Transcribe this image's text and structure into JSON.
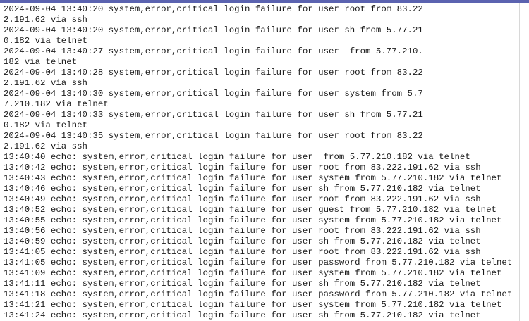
{
  "colors": {
    "top_bar": "#5b63b0",
    "background": "#ffffff",
    "text": "#1a1a1a"
  },
  "log": {
    "lines": [
      "2024-09-04 13:40:20 system,error,critical login failure for user root from 83.22",
      "2.191.62 via ssh",
      "2024-09-04 13:40:20 system,error,critical login failure for user sh from 5.77.21",
      "0.182 via telnet",
      "2024-09-04 13:40:27 system,error,critical login failure for user  from 5.77.210.",
      "182 via telnet",
      "2024-09-04 13:40:28 system,error,critical login failure for user root from 83.22",
      "2.191.62 via ssh",
      "2024-09-04 13:40:30 system,error,critical login failure for user system from 5.7",
      "7.210.182 via telnet",
      "2024-09-04 13:40:33 system,error,critical login failure for user sh from 5.77.21",
      "0.182 via telnet",
      "2024-09-04 13:40:35 system,error,critical login failure for user root from 83.22",
      "2.191.62 via ssh",
      "13:40:40 echo: system,error,critical login failure for user  from 5.77.210.182 via telnet",
      "13:40:42 echo: system,error,critical login failure for user root from 83.222.191.62 via ssh",
      "13:40:43 echo: system,error,critical login failure for user system from 5.77.210.182 via telnet",
      "13:40:46 echo: system,error,critical login failure for user sh from 5.77.210.182 via telnet",
      "13:40:49 echo: system,error,critical login failure for user root from 83.222.191.62 via ssh",
      "13:40:52 echo: system,error,critical login failure for user guest from 5.77.210.182 via telnet",
      "13:40:55 echo: system,error,critical login failure for user system from 5.77.210.182 via telnet",
      "13:40:56 echo: system,error,critical login failure for user root from 83.222.191.62 via ssh",
      "13:40:59 echo: system,error,critical login failure for user sh from 5.77.210.182 via telnet",
      "13:41:05 echo: system,error,critical login failure for user root from 83.222.191.62 via ssh",
      "13:41:05 echo: system,error,critical login failure for user password from 5.77.210.182 via telnet",
      "13:41:09 echo: system,error,critical login failure for user system from 5.77.210.182 via telnet",
      "13:41:11 echo: system,error,critical login failure for user sh from 5.77.210.182 via telnet",
      "13:41:18 echo: system,error,critical login failure for user password from 5.77.210.182 via telnet",
      "13:41:21 echo: system,error,critical login failure for user system from 5.77.210.182 via telnet",
      "13:41:24 echo: system,error,critical login failure for user sh from 5.77.210.182 via telnet"
    ]
  }
}
